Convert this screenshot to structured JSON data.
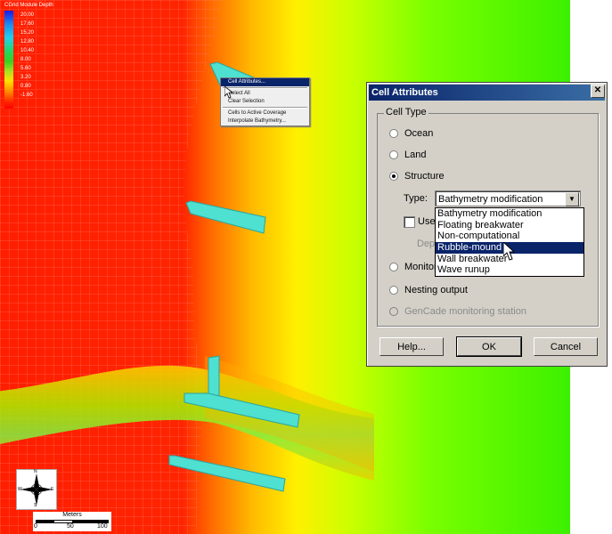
{
  "legend": {
    "title": "CGrid Module Depth",
    "values": [
      "20.00",
      "17.60",
      "15.20",
      "12.80",
      "10.40",
      "8.00",
      "5.60",
      "3.20",
      "0.80",
      "-1.60"
    ]
  },
  "context_menu": {
    "items": [
      "Cell Attributes...",
      "Select All",
      "Clear Selection",
      "Cells to Active Coverage",
      "Interpolate Bathymetry..."
    ]
  },
  "dialog": {
    "title": "Cell Attributes",
    "close": "✕",
    "group_label": "Cell Type",
    "options": {
      "ocean": "Ocean",
      "land": "Land",
      "structure": "Structure",
      "monitor": "Monitor",
      "nesting": "Nesting output",
      "gencade": "GenCade monitoring station"
    },
    "selected_option": "Structure",
    "type_label": "Type:",
    "type_value": "Bathymetry modification",
    "use_label": "Use",
    "depth_label": "Dep",
    "type_options": [
      "Bathymetry modification",
      "Floating breakwater",
      "Non-computational",
      "Rubble-mound",
      "Wall breakwater",
      "Wave runup"
    ],
    "highlighted_type": "Rubble-mound",
    "buttons": {
      "help": "Help...",
      "ok": "OK",
      "cancel": "Cancel"
    }
  },
  "scale_bar": {
    "title": "Meters",
    "ticks": [
      "0",
      "50",
      "100"
    ]
  },
  "compass": {
    "n": "N",
    "s": "S",
    "e": "E",
    "w": "W"
  },
  "colors": {
    "accent": "#0a246a",
    "dialog_bg": "#d4d0c8"
  }
}
